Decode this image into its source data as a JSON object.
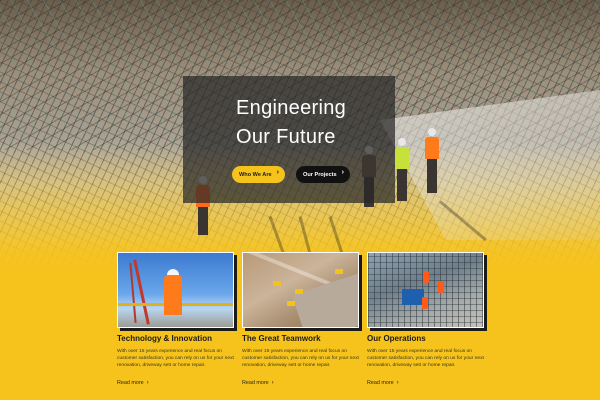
{
  "hero": {
    "title_line1": "Engineering",
    "title_line2": "Our Future",
    "primary_button": "Who We Are",
    "secondary_button": "Our Projects"
  },
  "cards": [
    {
      "title": "Technology & Innovation",
      "text": "With over 15 years experience and real focus on customer satisfaction, you can rely on us for your next renovation, driveway sett or home repair.",
      "link": "Read more",
      "image_icon": "worker-on-tower-photo"
    },
    {
      "title": "The Great Teamwork",
      "text": "With over 15 years experience and real focus on customer satisfaction, you can rely on us for your next renovation, driveway sett or home repair.",
      "link": "Read more",
      "image_icon": "excavation-site-photo"
    },
    {
      "title": "Our Operations",
      "text": "With over 15 years experience and real focus on customer satisfaction, you can rely on us for your next renovation, driveway sett or home repair.",
      "link": "Read more",
      "image_icon": "construction-operations-photo"
    }
  ],
  "icons": {
    "button_arrow": "chevron-right-icon",
    "link_arrow": "chevron-right-icon"
  },
  "colors": {
    "accent_yellow": "#f6c31c",
    "dark": "#111111",
    "overlay": "#282828"
  }
}
